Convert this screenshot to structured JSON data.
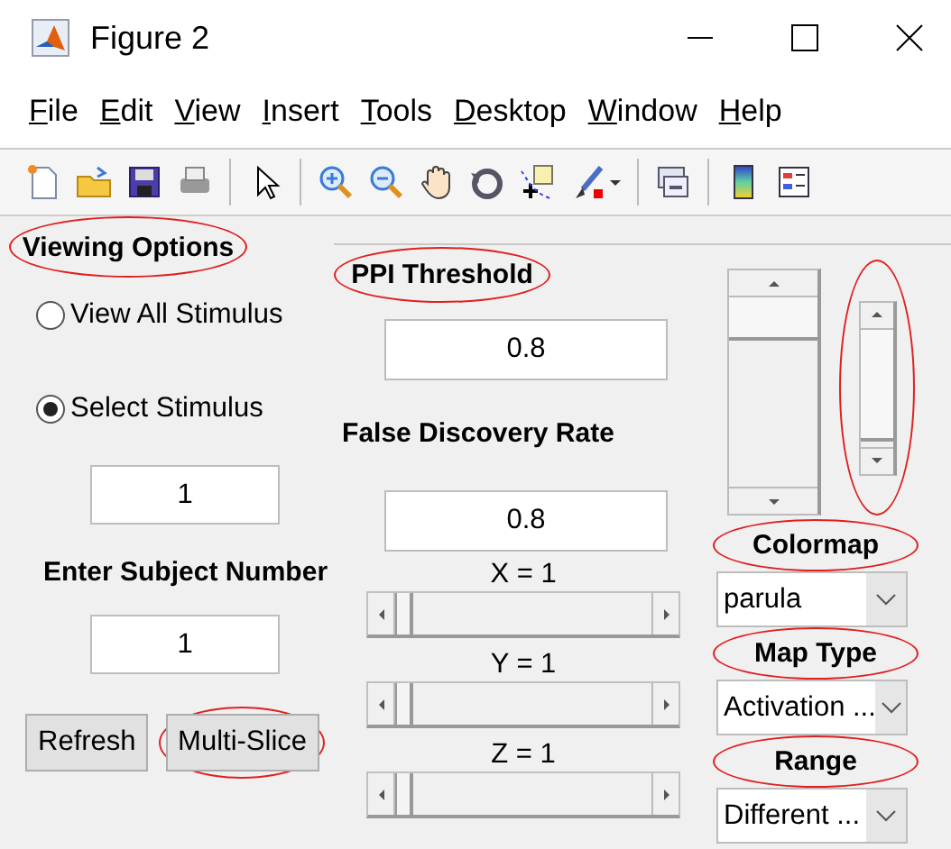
{
  "window": {
    "title": "Figure 2"
  },
  "menu": [
    "File",
    "Edit",
    "View",
    "Insert",
    "Tools",
    "Desktop",
    "Window",
    "Help"
  ],
  "viewing_options": {
    "title": "Viewing Options",
    "highlighted": true,
    "radios": [
      {
        "label": "View All Stimulus",
        "selected": false
      },
      {
        "label": "Select Stimulus",
        "selected": true
      }
    ],
    "stimulus_field": {
      "value": "1"
    },
    "subject_label": "Enter Subject Number",
    "subject_field": {
      "value": "1"
    },
    "buttons": [
      {
        "label": "Refresh",
        "highlighted": false
      },
      {
        "label": "Multi-Slice",
        "highlighted": true
      }
    ]
  },
  "ppi_threshold": {
    "label": "PPI Threshold",
    "highlighted": true,
    "value": "0.8"
  },
  "false_discovery_rate": {
    "label": "False Discovery Rate",
    "highlighted": false,
    "value": "0.8"
  },
  "sliders": [
    {
      "label": "X = 1",
      "level": 0
    },
    {
      "label": "Y = 1",
      "level": 0
    },
    {
      "label": "Z = 1",
      "level": 0
    }
  ],
  "scrollbars": [
    {
      "highlighted": false
    },
    {
      "highlighted": true
    }
  ],
  "dropdowns": [
    {
      "label": "Colormap",
      "highlighted": true,
      "value": "parula"
    },
    {
      "label": "Map Type",
      "highlighted": true,
      "value": "Activation ..."
    },
    {
      "label": "Range",
      "highlighted": true,
      "value": "Different ..."
    }
  ]
}
